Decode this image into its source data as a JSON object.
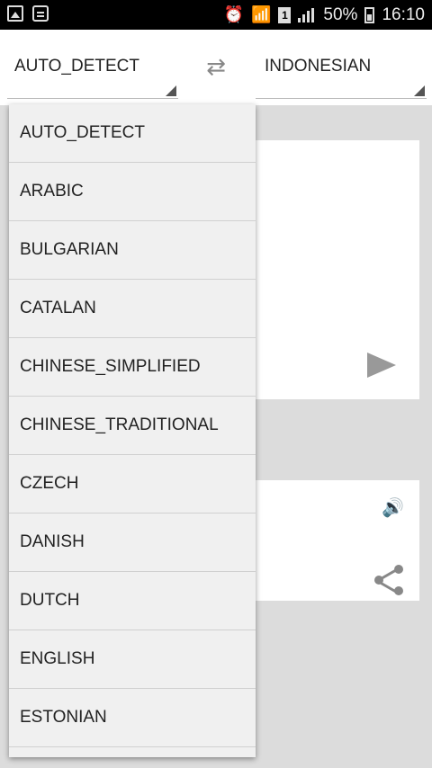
{
  "status_bar": {
    "battery": "50%",
    "time": "16:10",
    "sim": "1"
  },
  "translator": {
    "source_language": "AUTO_DETECT",
    "target_language": "INDONESIAN"
  },
  "dropdown": {
    "options": [
      "AUTO_DETECT",
      "ARABIC",
      "BULGARIAN",
      "CATALAN",
      "CHINESE_SIMPLIFIED",
      "CHINESE_TRADITIONAL",
      "CZECH",
      "DANISH",
      "DUTCH",
      "ENGLISH",
      "ESTONIAN"
    ]
  },
  "icons": {
    "status_left": [
      "gallery-icon",
      "chat-icon"
    ],
    "status_right": [
      "alarm-icon",
      "wifi-icon",
      "sim-icon",
      "signal-icon",
      "battery-icon"
    ],
    "swap": "swap-icon",
    "send": "send-icon",
    "speaker": "speaker-icon",
    "share": "share-icon"
  }
}
